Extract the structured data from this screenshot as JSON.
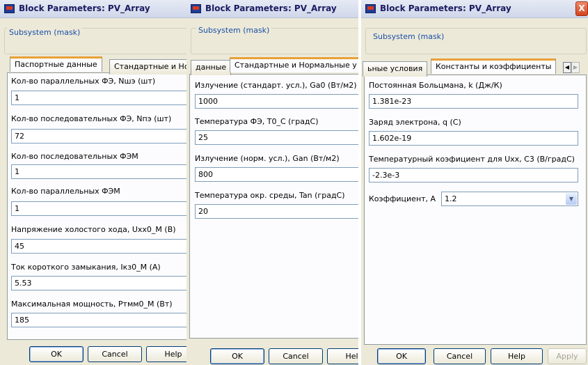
{
  "windows": [
    {
      "title": "Block Parameters: PV_Array",
      "subsystem_label": "Subsystem (mask)",
      "tabs": [
        "Паспортные данные",
        "Стандартные и Но"
      ],
      "fields": [
        {
          "label": "Кол-во параллельных ФЭ, Nшэ (шт)",
          "value": "1"
        },
        {
          "label": "Кол-во последовательных ФЭ, Nпэ (шт)",
          "value": "72"
        },
        {
          "label": "Кол-во последовательных ФЭМ",
          "value": "1"
        },
        {
          "label": "Кол-во параллельных ФЭМ",
          "value": "1"
        },
        {
          "label": "Напряжение холостого хода, Uxx0_M (В)",
          "value": "45"
        },
        {
          "label": "Ток короткого замыкания, Iкз0_M (А)",
          "value": "5.53"
        },
        {
          "label": "Максимальная мощность, Ртмм0_М (Вт)",
          "value": "185"
        }
      ],
      "buttons": {
        "ok": "OK",
        "cancel": "Cancel",
        "help": "Help"
      }
    },
    {
      "title": "Block Parameters: PV_Array",
      "subsystem_label": "Subsystem (mask)",
      "tabs": [
        "данные",
        "Стандартные и Нормальные у"
      ],
      "fields": [
        {
          "label": "Излучение (стандарт. усл.), Ga0 (Вт/м2)",
          "value": "1000"
        },
        {
          "label": "Температура ФЭ, T0_C (градС)",
          "value": "25"
        },
        {
          "label": "Излучение (норм. усл.), Gan (Вт/м2)",
          "value": "800"
        },
        {
          "label": "Температура окр. среды, Tan (градС)",
          "value": "20"
        }
      ],
      "buttons": {
        "ok": "OK",
        "cancel": "Cancel",
        "help": "Help"
      }
    },
    {
      "title": "Block Parameters: PV_Array",
      "subsystem_label": "Subsystem (mask)",
      "close_symbol": "X",
      "tabs": [
        "ьные условия",
        "Константы и коэффициенты"
      ],
      "fields": [
        {
          "label": "Постоянная Больцмана, k (Дж/К)",
          "value": "1.381e-23"
        },
        {
          "label": "Заряд электрона, q (С)",
          "value": "1.602e-19"
        },
        {
          "label": "Температурный коэфициент для Uxx, C3 (В/градС)",
          "value": "-2.3e-3"
        }
      ],
      "combo": {
        "label": "Коэффициент, А",
        "value": "1.2"
      },
      "buttons": {
        "ok": "OK",
        "cancel": "Cancel",
        "help": "Help",
        "apply": "Apply"
      }
    }
  ]
}
